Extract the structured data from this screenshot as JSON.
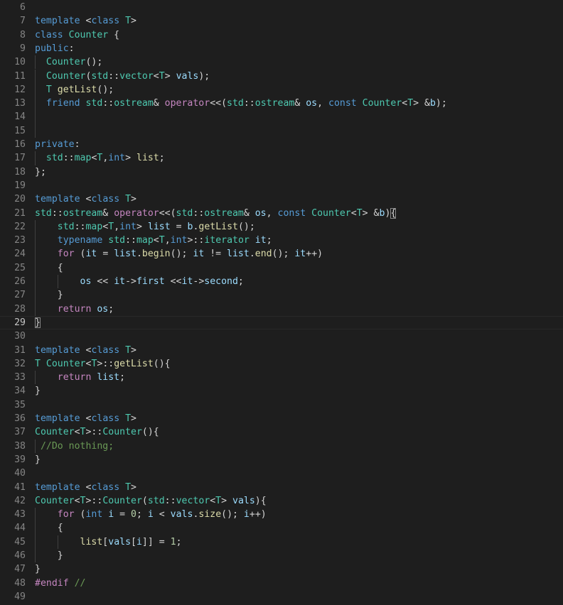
{
  "editor": {
    "language": "cpp",
    "theme": "dark-plus",
    "background_color": "#1e1e1e",
    "gutter_color": "#858585",
    "active_line_number": 29,
    "first_visible_line": 6,
    "last_visible_line": 49,
    "colors": {
      "keyword": "#569cd6",
      "control": "#c586c0",
      "type": "#4ec9b0",
      "function": "#dcdcaa",
      "variable": "#9cdcfe",
      "number": "#b5cea8",
      "comment": "#6a9955",
      "plain": "#d4d4d4",
      "indent_guide": "#404040",
      "active_line_border": "#282828",
      "bracket_match": "#888888"
    }
  },
  "lines": [
    {
      "n": 6,
      "text": ""
    },
    {
      "n": 7,
      "text": "template <class T>"
    },
    {
      "n": 8,
      "text": "class Counter {"
    },
    {
      "n": 9,
      "text": "public:"
    },
    {
      "n": 10,
      "text": "  Counter();"
    },
    {
      "n": 11,
      "text": "  Counter(std::vector<T> vals);"
    },
    {
      "n": 12,
      "text": "  T getList();"
    },
    {
      "n": 13,
      "text": "  friend std::ostream& operator<<(std::ostream& os, const Counter<T> &b);"
    },
    {
      "n": 14,
      "text": ""
    },
    {
      "n": 15,
      "text": ""
    },
    {
      "n": 16,
      "text": "private:"
    },
    {
      "n": 17,
      "text": "  std::map<T,int> list;"
    },
    {
      "n": 18,
      "text": "};"
    },
    {
      "n": 19,
      "text": ""
    },
    {
      "n": 20,
      "text": "template <class T>"
    },
    {
      "n": 21,
      "text": "std::ostream& operator<<(std::ostream& os, const Counter<T> &b){"
    },
    {
      "n": 22,
      "text": "    std::map<T,int> list = b.getList();"
    },
    {
      "n": 23,
      "text": "    typename std::map<T,int>::iterator it;"
    },
    {
      "n": 24,
      "text": "    for (it = list.begin(); it != list.end(); it++)"
    },
    {
      "n": 25,
      "text": "    {"
    },
    {
      "n": 26,
      "text": "        os << it->first <<it->second;"
    },
    {
      "n": 27,
      "text": "    }"
    },
    {
      "n": 28,
      "text": "    return os;"
    },
    {
      "n": 29,
      "text": "}"
    },
    {
      "n": 30,
      "text": ""
    },
    {
      "n": 31,
      "text": "template <class T>"
    },
    {
      "n": 32,
      "text": "T Counter<T>::getList(){"
    },
    {
      "n": 33,
      "text": "    return list;"
    },
    {
      "n": 34,
      "text": "}"
    },
    {
      "n": 35,
      "text": ""
    },
    {
      "n": 36,
      "text": "template <class T>"
    },
    {
      "n": 37,
      "text": "Counter<T>::Counter(){"
    },
    {
      "n": 38,
      "text": " //Do nothing;"
    },
    {
      "n": 39,
      "text": "}"
    },
    {
      "n": 40,
      "text": ""
    },
    {
      "n": 41,
      "text": "template <class T>"
    },
    {
      "n": 42,
      "text": "Counter<T>::Counter(std::vector<T> vals){"
    },
    {
      "n": 43,
      "text": "    for (int i = 0; i < vals.size(); i++)"
    },
    {
      "n": 44,
      "text": "    {"
    },
    {
      "n": 45,
      "text": "        list[vals[i]] = 1;"
    },
    {
      "n": 46,
      "text": "    }"
    },
    {
      "n": 47,
      "text": "}"
    },
    {
      "n": 48,
      "text": "#endif //"
    },
    {
      "n": 49,
      "text": ""
    }
  ],
  "tokens": {
    "6": [],
    "7": [
      [
        "template",
        "k"
      ],
      [
        " ",
        "pl"
      ],
      [
        "<",
        "pl"
      ],
      [
        "class",
        "k"
      ],
      [
        " ",
        "pl"
      ],
      [
        "T",
        "ty"
      ],
      [
        ">",
        "pl"
      ]
    ],
    "8": [
      [
        "class",
        "k"
      ],
      [
        " ",
        "pl"
      ],
      [
        "Counter",
        "ty"
      ],
      [
        " {",
        "pl"
      ]
    ],
    "9": [
      [
        "public",
        "k"
      ],
      [
        ":",
        "pl"
      ]
    ],
    "10": [
      [
        "  ",
        "pl"
      ],
      [
        "Counter",
        "ty"
      ],
      [
        "();",
        "pl"
      ]
    ],
    "11": [
      [
        "  ",
        "pl"
      ],
      [
        "Counter",
        "ty"
      ],
      [
        "(",
        "pl"
      ],
      [
        "std",
        "ty"
      ],
      [
        "::",
        "pl"
      ],
      [
        "vector",
        "ty"
      ],
      [
        "<",
        "pl"
      ],
      [
        "T",
        "ty"
      ],
      [
        "> ",
        "pl"
      ],
      [
        "vals",
        "var"
      ],
      [
        ");",
        "pl"
      ]
    ],
    "12": [
      [
        "  ",
        "pl"
      ],
      [
        "T",
        "ty"
      ],
      [
        " ",
        "pl"
      ],
      [
        "getList",
        "fn"
      ],
      [
        "();",
        "pl"
      ]
    ],
    "13": [
      [
        "  ",
        "pl"
      ],
      [
        "friend",
        "k"
      ],
      [
        " ",
        "pl"
      ],
      [
        "std",
        "ty"
      ],
      [
        "::",
        "pl"
      ],
      [
        "ostream",
        "ty"
      ],
      [
        "& ",
        "pl"
      ],
      [
        "operator",
        "ctl"
      ],
      [
        "<<(",
        "pl"
      ],
      [
        "std",
        "ty"
      ],
      [
        "::",
        "pl"
      ],
      [
        "ostream",
        "ty"
      ],
      [
        "& ",
        "pl"
      ],
      [
        "os",
        "var"
      ],
      [
        ", ",
        "pl"
      ],
      [
        "const",
        "k"
      ],
      [
        " ",
        "pl"
      ],
      [
        "Counter",
        "ty"
      ],
      [
        "<",
        "pl"
      ],
      [
        "T",
        "ty"
      ],
      [
        "> &",
        "pl"
      ],
      [
        "b",
        "var"
      ],
      [
        ");",
        "pl"
      ]
    ],
    "14": [],
    "15": [],
    "16": [
      [
        "private",
        "k"
      ],
      [
        ":",
        "pl"
      ]
    ],
    "17": [
      [
        "  ",
        "pl"
      ],
      [
        "std",
        "ty"
      ],
      [
        "::",
        "pl"
      ],
      [
        "map",
        "ty"
      ],
      [
        "<",
        "pl"
      ],
      [
        "T",
        "ty"
      ],
      [
        ",",
        "pl"
      ],
      [
        "int",
        "k"
      ],
      [
        "> ",
        "pl"
      ],
      [
        "list",
        "fn"
      ],
      [
        ";",
        "pl"
      ]
    ],
    "18": [
      [
        "};",
        "pl"
      ]
    ],
    "19": [],
    "20": [
      [
        "template",
        "k"
      ],
      [
        " ",
        "pl"
      ],
      [
        "<",
        "pl"
      ],
      [
        "class",
        "k"
      ],
      [
        " ",
        "pl"
      ],
      [
        "T",
        "ty"
      ],
      [
        ">",
        "pl"
      ]
    ],
    "21": [
      [
        "std",
        "ty"
      ],
      [
        "::",
        "pl"
      ],
      [
        "ostream",
        "ty"
      ],
      [
        "& ",
        "pl"
      ],
      [
        "operator",
        "ctl"
      ],
      [
        "<<(",
        "pl"
      ],
      [
        "std",
        "ty"
      ],
      [
        "::",
        "pl"
      ],
      [
        "ostream",
        "ty"
      ],
      [
        "& ",
        "pl"
      ],
      [
        "os",
        "var"
      ],
      [
        ", ",
        "pl"
      ],
      [
        "const",
        "k"
      ],
      [
        " ",
        "pl"
      ],
      [
        "Counter",
        "ty"
      ],
      [
        "<",
        "pl"
      ],
      [
        "T",
        "ty"
      ],
      [
        "> &",
        "pl"
      ],
      [
        "b",
        "var"
      ],
      [
        ")",
        "pl"
      ],
      [
        "{",
        "pl brk"
      ]
    ],
    "22": [
      [
        "    ",
        "pl"
      ],
      [
        "std",
        "ty"
      ],
      [
        "::",
        "pl"
      ],
      [
        "map",
        "ty"
      ],
      [
        "<",
        "pl"
      ],
      [
        "T",
        "ty"
      ],
      [
        ",",
        "pl"
      ],
      [
        "int",
        "k"
      ],
      [
        "> ",
        "pl"
      ],
      [
        "list",
        "var"
      ],
      [
        " = ",
        "pl"
      ],
      [
        "b",
        "var"
      ],
      [
        ".",
        "pl"
      ],
      [
        "getList",
        "fn"
      ],
      [
        "();",
        "pl"
      ]
    ],
    "23": [
      [
        "    ",
        "pl"
      ],
      [
        "typename",
        "k"
      ],
      [
        " ",
        "pl"
      ],
      [
        "std",
        "ty"
      ],
      [
        "::",
        "pl"
      ],
      [
        "map",
        "ty"
      ],
      [
        "<",
        "pl"
      ],
      [
        "T",
        "ty"
      ],
      [
        ",",
        "pl"
      ],
      [
        "int",
        "k"
      ],
      [
        ">::",
        "pl"
      ],
      [
        "iterator",
        "ty"
      ],
      [
        " ",
        "pl"
      ],
      [
        "it",
        "var"
      ],
      [
        ";",
        "pl"
      ]
    ],
    "24": [
      [
        "    ",
        "pl"
      ],
      [
        "for",
        "ctl"
      ],
      [
        " (",
        "pl"
      ],
      [
        "it",
        "var"
      ],
      [
        " = ",
        "pl"
      ],
      [
        "list",
        "var"
      ],
      [
        ".",
        "pl"
      ],
      [
        "begin",
        "fn"
      ],
      [
        "(); ",
        "pl"
      ],
      [
        "it",
        "var"
      ],
      [
        " != ",
        "pl"
      ],
      [
        "list",
        "var"
      ],
      [
        ".",
        "pl"
      ],
      [
        "end",
        "fn"
      ],
      [
        "(); ",
        "pl"
      ],
      [
        "it",
        "var"
      ],
      [
        "++)",
        "pl"
      ]
    ],
    "25": [
      [
        "    {",
        "pl"
      ]
    ],
    "26": [
      [
        "        ",
        "pl"
      ],
      [
        "os",
        "var"
      ],
      [
        " << ",
        "pl"
      ],
      [
        "it",
        "var"
      ],
      [
        "->",
        "pl"
      ],
      [
        "first",
        "var"
      ],
      [
        " <<",
        "pl"
      ],
      [
        "it",
        "var"
      ],
      [
        "->",
        "pl"
      ],
      [
        "second",
        "var"
      ],
      [
        ";",
        "pl"
      ]
    ],
    "27": [
      [
        "    }",
        "pl"
      ]
    ],
    "28": [
      [
        "    ",
        "pl"
      ],
      [
        "return",
        "ctl"
      ],
      [
        " ",
        "pl"
      ],
      [
        "os",
        "var"
      ],
      [
        ";",
        "pl"
      ]
    ],
    "29": [
      [
        "}",
        "pl brk"
      ]
    ],
    "30": [],
    "31": [
      [
        "template",
        "k"
      ],
      [
        " ",
        "pl"
      ],
      [
        "<",
        "pl"
      ],
      [
        "class",
        "k"
      ],
      [
        " ",
        "pl"
      ],
      [
        "T",
        "ty"
      ],
      [
        ">",
        "pl"
      ]
    ],
    "32": [
      [
        "T",
        "ty"
      ],
      [
        " ",
        "pl"
      ],
      [
        "Counter",
        "ty"
      ],
      [
        "<",
        "pl"
      ],
      [
        "T",
        "ty"
      ],
      [
        ">::",
        "pl"
      ],
      [
        "getList",
        "fn"
      ],
      [
        "(){",
        "pl"
      ]
    ],
    "33": [
      [
        "    ",
        "pl"
      ],
      [
        "return",
        "ctl"
      ],
      [
        " ",
        "pl"
      ],
      [
        "list",
        "var"
      ],
      [
        ";",
        "pl"
      ]
    ],
    "34": [
      [
        "}",
        "pl"
      ]
    ],
    "35": [],
    "36": [
      [
        "template",
        "k"
      ],
      [
        " ",
        "pl"
      ],
      [
        "<",
        "pl"
      ],
      [
        "class",
        "k"
      ],
      [
        " ",
        "pl"
      ],
      [
        "T",
        "ty"
      ],
      [
        ">",
        "pl"
      ]
    ],
    "37": [
      [
        "Counter",
        "ty"
      ],
      [
        "<",
        "pl"
      ],
      [
        "T",
        "ty"
      ],
      [
        ">::",
        "pl"
      ],
      [
        "Counter",
        "ty"
      ],
      [
        "(){",
        "pl"
      ]
    ],
    "38": [
      [
        " ",
        "pl"
      ],
      [
        "//Do nothing;",
        "cmt"
      ]
    ],
    "39": [
      [
        "}",
        "pl"
      ]
    ],
    "40": [],
    "41": [
      [
        "template",
        "k"
      ],
      [
        " ",
        "pl"
      ],
      [
        "<",
        "pl"
      ],
      [
        "class",
        "k"
      ],
      [
        " ",
        "pl"
      ],
      [
        "T",
        "ty"
      ],
      [
        ">",
        "pl"
      ]
    ],
    "42": [
      [
        "Counter",
        "ty"
      ],
      [
        "<",
        "pl"
      ],
      [
        "T",
        "ty"
      ],
      [
        ">::",
        "pl"
      ],
      [
        "Counter",
        "ty"
      ],
      [
        "(",
        "pl"
      ],
      [
        "std",
        "ty"
      ],
      [
        "::",
        "pl"
      ],
      [
        "vector",
        "ty"
      ],
      [
        "<",
        "pl"
      ],
      [
        "T",
        "ty"
      ],
      [
        "> ",
        "pl"
      ],
      [
        "vals",
        "var"
      ],
      [
        "){",
        "pl"
      ]
    ],
    "43": [
      [
        "    ",
        "pl"
      ],
      [
        "for",
        "ctl"
      ],
      [
        " (",
        "pl"
      ],
      [
        "int",
        "k"
      ],
      [
        " ",
        "pl"
      ],
      [
        "i",
        "var"
      ],
      [
        " = ",
        "pl"
      ],
      [
        "0",
        "num"
      ],
      [
        "; ",
        "pl"
      ],
      [
        "i",
        "var"
      ],
      [
        " < ",
        "pl"
      ],
      [
        "vals",
        "var"
      ],
      [
        ".",
        "pl"
      ],
      [
        "size",
        "fn"
      ],
      [
        "(); ",
        "pl"
      ],
      [
        "i",
        "var"
      ],
      [
        "++)",
        "pl"
      ]
    ],
    "44": [
      [
        "    {",
        "pl"
      ]
    ],
    "45": [
      [
        "        ",
        "pl"
      ],
      [
        "list",
        "fn"
      ],
      [
        "[",
        "pl"
      ],
      [
        "vals",
        "var"
      ],
      [
        "[",
        "pl"
      ],
      [
        "i",
        "var"
      ],
      [
        "]] = ",
        "pl"
      ],
      [
        "1",
        "num"
      ],
      [
        ";",
        "pl"
      ]
    ],
    "46": [
      [
        "    }",
        "pl"
      ]
    ],
    "47": [
      [
        "}",
        "pl"
      ]
    ],
    "48": [
      [
        "#endif",
        "ctl"
      ],
      [
        " ",
        "pl"
      ],
      [
        "//",
        "cmt"
      ]
    ],
    "49": []
  },
  "indent_guides": {
    "10": [
      1
    ],
    "11": [
      1
    ],
    "12": [
      1
    ],
    "13": [
      1
    ],
    "14": [
      1
    ],
    "15": [
      1
    ],
    "17": [
      1
    ],
    "22": [
      1
    ],
    "23": [
      1
    ],
    "24": [
      1
    ],
    "25": [
      1
    ],
    "26": [
      1,
      2
    ],
    "27": [
      1
    ],
    "28": [
      1
    ],
    "33": [
      1
    ],
    "38": [
      1
    ],
    "43": [
      1
    ],
    "44": [
      1
    ],
    "45": [
      1,
      2
    ],
    "46": [
      1
    ]
  }
}
